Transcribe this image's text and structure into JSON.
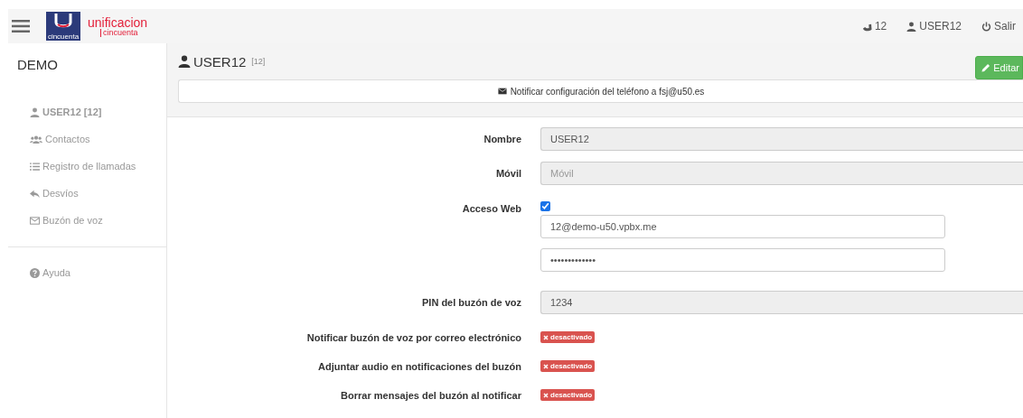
{
  "header": {
    "logo": {
      "badge": "cincuenta",
      "line1": "unificacion",
      "line2": "cincuenta"
    },
    "nav": [
      {
        "label": "12"
      },
      {
        "label": "USER12"
      },
      {
        "label": "Salir"
      }
    ]
  },
  "sidebar": {
    "title": "DEMO",
    "items": [
      {
        "label": "USER12 [12]",
        "selected": true
      },
      {
        "label": "Contactos",
        "selected": false
      },
      {
        "label": "Registro de llamadas",
        "selected": false
      },
      {
        "label": "Desvíos",
        "selected": false
      },
      {
        "label": "Buzón de voz",
        "selected": false
      }
    ],
    "help": {
      "label": "Ayuda"
    }
  },
  "page": {
    "title": "USER12",
    "subtitle": "[12]",
    "edit_button": "Editar",
    "notify_button": "Notificar configuración del teléfono a fsj@u50.es"
  },
  "form": [
    {
      "kind": "readonly",
      "label": "Nombre",
      "value": "USER12"
    },
    {
      "kind": "readonly",
      "label": "Móvil",
      "placeholder": "Móvil"
    },
    {
      "kind": "checkbox",
      "label": "Acceso Web",
      "checked": true
    },
    {
      "kind": "input",
      "value": "12@demo-u50.vpbx.me"
    },
    {
      "kind": "input",
      "value": "•••••••••••••"
    },
    {
      "kind": "readonly",
      "label": "PIN del buzón de voz",
      "value": "1234"
    },
    {
      "kind": "toggle",
      "label": "Notificar buzón de voz por correo electrónico",
      "on": false,
      "text": "desactivado"
    },
    {
      "kind": "toggle",
      "label": "Adjuntar audio en notificaciones del buzón",
      "on": false,
      "text": "desactivado"
    },
    {
      "kind": "toggle",
      "label": "Borrar mensajes del buzón al notificar",
      "on": false,
      "text": "desactivado"
    }
  ]
}
